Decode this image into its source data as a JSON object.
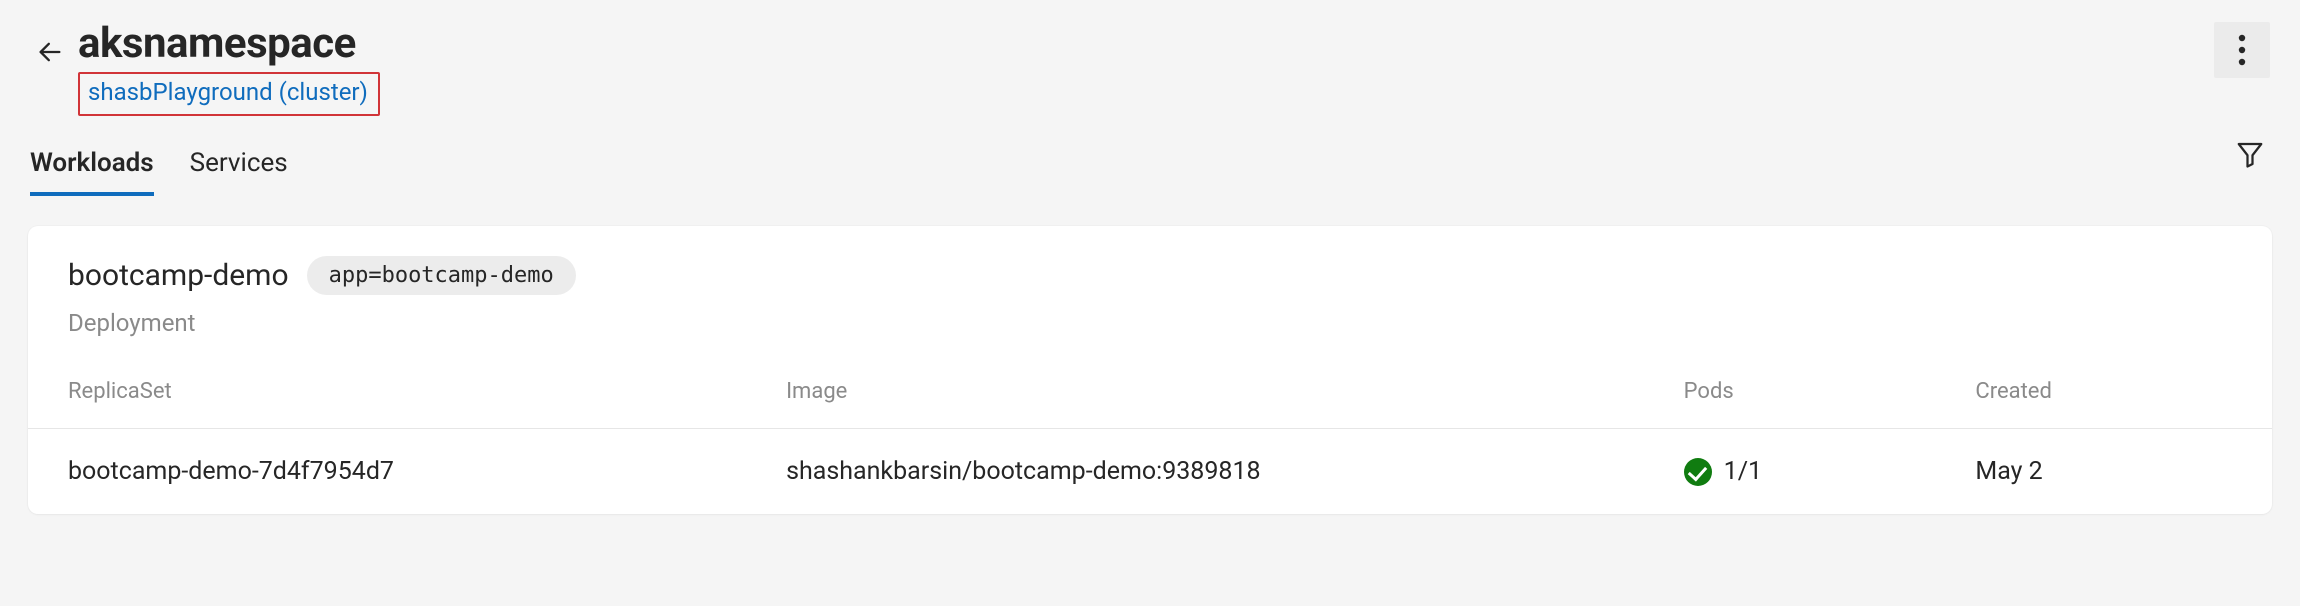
{
  "header": {
    "title": "aksnamespace",
    "cluster_link": "shasbPlayground (cluster)"
  },
  "tabs": [
    {
      "label": "Workloads",
      "active": true
    },
    {
      "label": "Services",
      "active": false
    }
  ],
  "workload": {
    "name": "bootcamp-demo",
    "tag": "app=bootcamp-demo",
    "kind": "Deployment",
    "columns": {
      "replicaset": "ReplicaSet",
      "image": "Image",
      "pods": "Pods",
      "created": "Created"
    },
    "rows": [
      {
        "replicaset": "bootcamp-demo-7d4f7954d7",
        "image": "shashankbarsin/bootcamp-demo:9389818",
        "pods": "1/1",
        "pods_status": "ok",
        "created": "May 2"
      }
    ]
  },
  "colors": {
    "accent": "#0f6cbd",
    "highlight_border": "#d13438",
    "status_ok": "#107c10"
  }
}
